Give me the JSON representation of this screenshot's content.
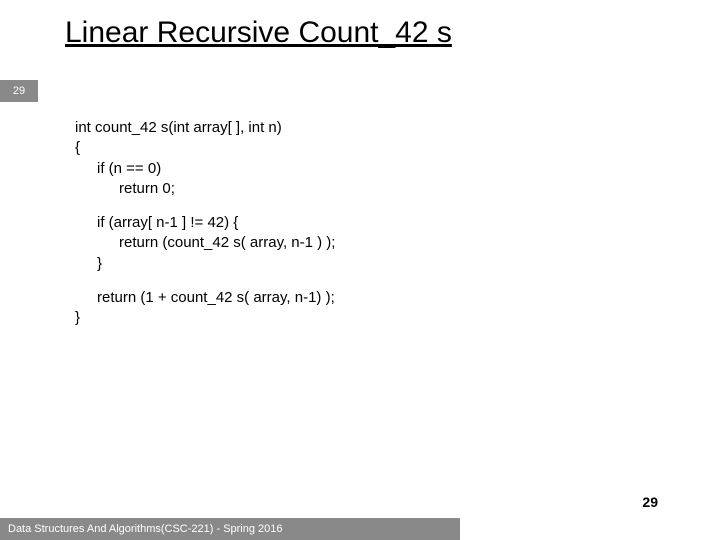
{
  "title": "Linear Recursive Count_42 s",
  "badge": "29",
  "code": {
    "l1": "int count_42 s(int array[ ], int n)",
    "l2": "{",
    "l3": "if (n == 0)",
    "l4": "return 0;",
    "l5": "if (array[ n-1 ] != 42) {",
    "l6": "return (count_42 s( array, n-1 ) );",
    "l7": "}",
    "l8": "return (1 + count_42 s( array, n-1) );",
    "l9": "}"
  },
  "page_number": "29",
  "footer": "Data Structures And Algorithms(CSC-221) - Spring 2016"
}
